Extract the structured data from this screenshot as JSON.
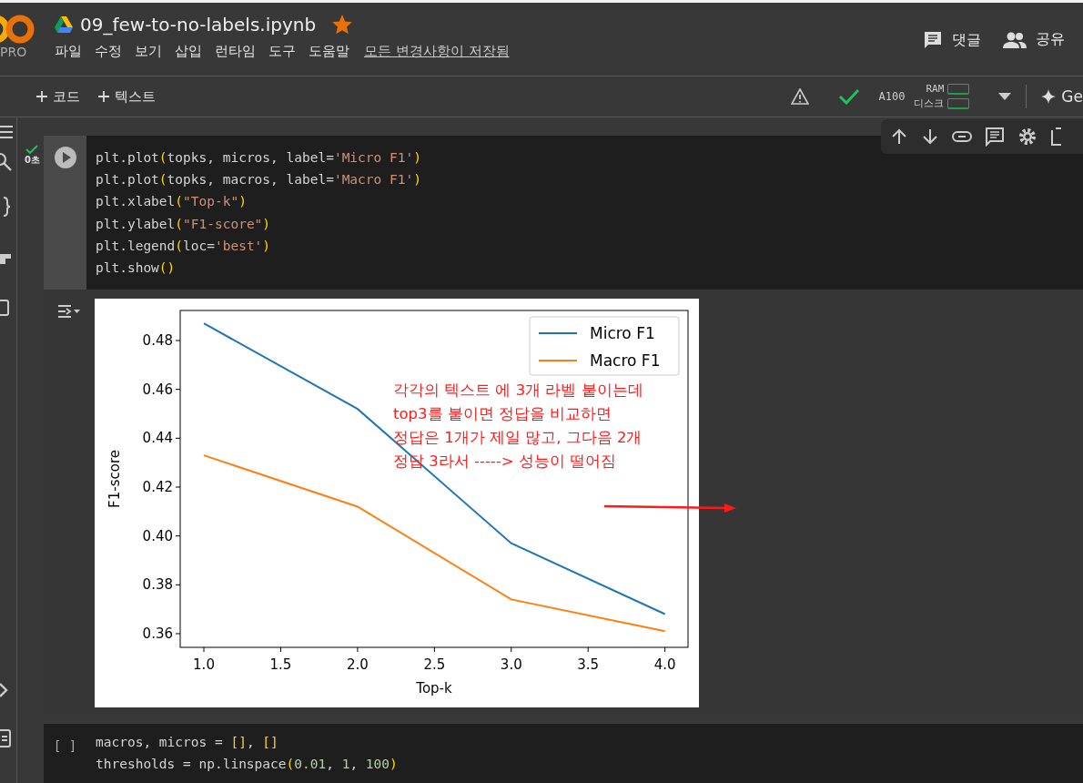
{
  "header": {
    "logo_badge": "PRO",
    "title": "09_few-to-no-labels.ipynb",
    "starred": true,
    "menu": [
      "파일",
      "수정",
      "보기",
      "삽입",
      "런타임",
      "도구",
      "도움말"
    ],
    "save_status": "모든 변경사항이 저장됨",
    "actions": [
      {
        "kind": "comment",
        "label": "댓글"
      },
      {
        "kind": "share",
        "label": "공유"
      }
    ]
  },
  "toolbar": {
    "add_buttons": [
      "코드",
      "텍스트"
    ],
    "gpu": "A100",
    "ram_label": "RAM",
    "disk_label": "디스크",
    "gemini_label": "Ge"
  },
  "cells": [
    {
      "focused": true,
      "exec_time": "0초",
      "lines": [
        [
          {
            "kind": "plain",
            "text": "plt.plot"
          },
          {
            "kind": "paren",
            "text": "("
          },
          {
            "kind": "plain",
            "text": "topks, micros, label="
          },
          {
            "kind": "string",
            "text": "'Micro F1'"
          },
          {
            "kind": "paren",
            "text": ")"
          }
        ],
        [
          {
            "kind": "plain",
            "text": "plt.plot"
          },
          {
            "kind": "paren",
            "text": "("
          },
          {
            "kind": "plain",
            "text": "topks, macros, label="
          },
          {
            "kind": "string",
            "text": "'Macro F1'"
          },
          {
            "kind": "paren",
            "text": ")"
          }
        ],
        [
          {
            "kind": "plain",
            "text": "plt.xlabel"
          },
          {
            "kind": "paren",
            "text": "("
          },
          {
            "kind": "string",
            "text": "\"Top-k\""
          },
          {
            "kind": "paren",
            "text": ")"
          }
        ],
        [
          {
            "kind": "plain",
            "text": "plt.ylabel"
          },
          {
            "kind": "paren",
            "text": "("
          },
          {
            "kind": "string",
            "text": "\"F1-score\""
          },
          {
            "kind": "paren",
            "text": ")"
          }
        ],
        [
          {
            "kind": "plain",
            "text": "plt.legend"
          },
          {
            "kind": "paren",
            "text": "("
          },
          {
            "kind": "plain",
            "text": "loc="
          },
          {
            "kind": "string",
            "text": "'best'"
          },
          {
            "kind": "paren",
            "text": ")"
          }
        ],
        [
          {
            "kind": "plain",
            "text": "plt.show"
          },
          {
            "kind": "paren",
            "text": "()"
          }
        ]
      ],
      "output": {
        "chart_data": {
          "type": "line",
          "legend": true,
          "xlabel": "Top-k",
          "ylabel": "F1-score",
          "x": [
            1,
            2,
            3,
            4
          ],
          "series": [
            {
              "name": "Micro F1",
              "color": "#1f77b4",
              "values": [
                0.487,
                0.452,
                0.397,
                0.368
              ]
            },
            {
              "name": "Macro F1",
              "color": "#ff7f0e",
              "values": [
                0.433,
                0.412,
                0.374,
                0.361
              ]
            }
          ],
          "xlim": [
            0.846,
            4.15
          ],
          "ylim": [
            0.3544,
            0.4923
          ],
          "xticks": [
            {
              "value": 1,
              "label": "1.0"
            },
            {
              "value": 1.5,
              "label": "1.5"
            },
            {
              "value": 2,
              "label": "2.0"
            },
            {
              "value": 2.5,
              "label": "2.5"
            },
            {
              "value": 3,
              "label": "3.0"
            },
            {
              "value": 3.5,
              "label": "3.5"
            },
            {
              "value": 4,
              "label": "4.0"
            }
          ],
          "yticks": [
            {
              "value": 0.36,
              "label": "0.36"
            },
            {
              "value": 0.38,
              "label": "0.38"
            },
            {
              "value": 0.4,
              "label": "0.40"
            },
            {
              "value": 0.42,
              "label": "0.42"
            },
            {
              "value": 0.44,
              "label": "0.44"
            },
            {
              "value": 0.46,
              "label": "0.46"
            },
            {
              "value": 0.48,
              "label": "0.48"
            }
          ]
        },
        "note": [
          "각각의 텍스트 에 3개 라벨 붙이는데",
          "top3를 붙이면 정답을 비교하면",
          "정답은 1개가 제일 많고, 그다음 2개",
          "정답 3라서 -----> 성능이 떨어짐"
        ]
      }
    },
    {
      "focused": false,
      "prompt": "[ ]",
      "lines": [
        [
          {
            "kind": "plain",
            "text": "macros, micros = "
          },
          {
            "kind": "paren",
            "text": "[]"
          },
          {
            "kind": "plain",
            "text": ", "
          },
          {
            "kind": "paren",
            "text": "[]"
          }
        ],
        [
          {
            "kind": "plain",
            "text": "thresholds = np.linspace"
          },
          {
            "kind": "paren",
            "text": "("
          },
          {
            "kind": "number",
            "text": "0.01"
          },
          {
            "kind": "plain",
            "text": ", "
          },
          {
            "kind": "number",
            "text": "1"
          },
          {
            "kind": "plain",
            "text": ", "
          },
          {
            "kind": "number",
            "text": "100"
          },
          {
            "kind": "paren",
            "text": ")"
          }
        ]
      ]
    }
  ]
}
